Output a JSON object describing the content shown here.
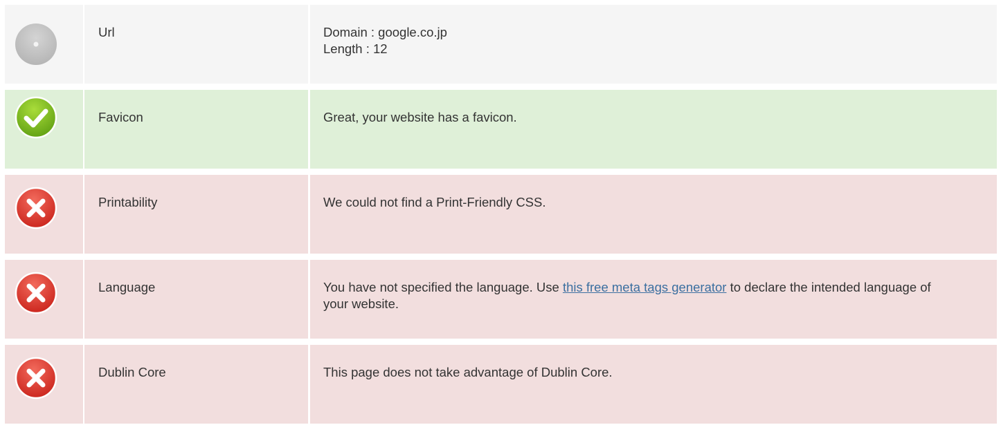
{
  "rows": [
    {
      "status": "neutral",
      "icon": "neutral-dot-icon",
      "label": "Url",
      "value_lines": [
        "Domain : google.co.jp",
        "Length : 12"
      ]
    },
    {
      "status": "pass",
      "icon": "check-icon",
      "label": "Favicon",
      "value": "Great, your website has a favicon."
    },
    {
      "status": "fail",
      "icon": "error-x-icon",
      "label": "Printability",
      "value": "We could not find a Print-Friendly CSS."
    },
    {
      "status": "fail",
      "icon": "error-x-icon",
      "label": "Language",
      "value_before": "You have not specified the language. Use ",
      "link_text": "this free meta tags generator",
      "value_after": " to declare the intended language of your website."
    },
    {
      "status": "fail",
      "icon": "error-x-icon",
      "label": "Dublin Core",
      "value": "This page does not take advantage of Dublin Core."
    }
  ],
  "colors": {
    "neutral_bg": "#f5f5f5",
    "pass_bg": "#dff0d8",
    "fail_bg": "#f2dede",
    "link": "#3b6fa0"
  }
}
